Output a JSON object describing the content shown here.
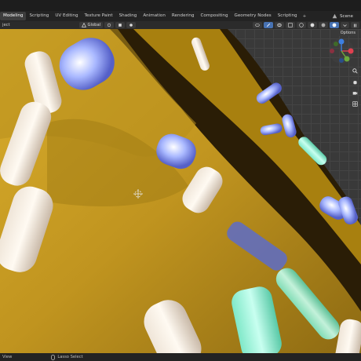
{
  "topbar": {
    "tabs": [
      "Modeling",
      "Scripting",
      "UV Editing",
      "Texture Paint",
      "Shading",
      "Animation",
      "Rendering",
      "Compositing",
      "Geometry Nodes",
      "Scripting"
    ],
    "add_tab": "+",
    "scene": "Scene"
  },
  "header": {
    "mode_label": "ject",
    "transform_orientation": "Global",
    "options_label": "Options"
  },
  "gizmo": {
    "axes": {
      "x": "X",
      "y": "Y",
      "z": "Z"
    },
    "colors": {
      "x": "#e04050",
      "y": "#6ca93c",
      "z": "#3d7fe0"
    }
  },
  "status": {
    "left": "View",
    "middle": "Lasso Select"
  },
  "colors": {
    "background": "#1d1d1d",
    "viewport": "#393939",
    "accent": "#4772b3",
    "donut_icing": "#c39a22"
  }
}
